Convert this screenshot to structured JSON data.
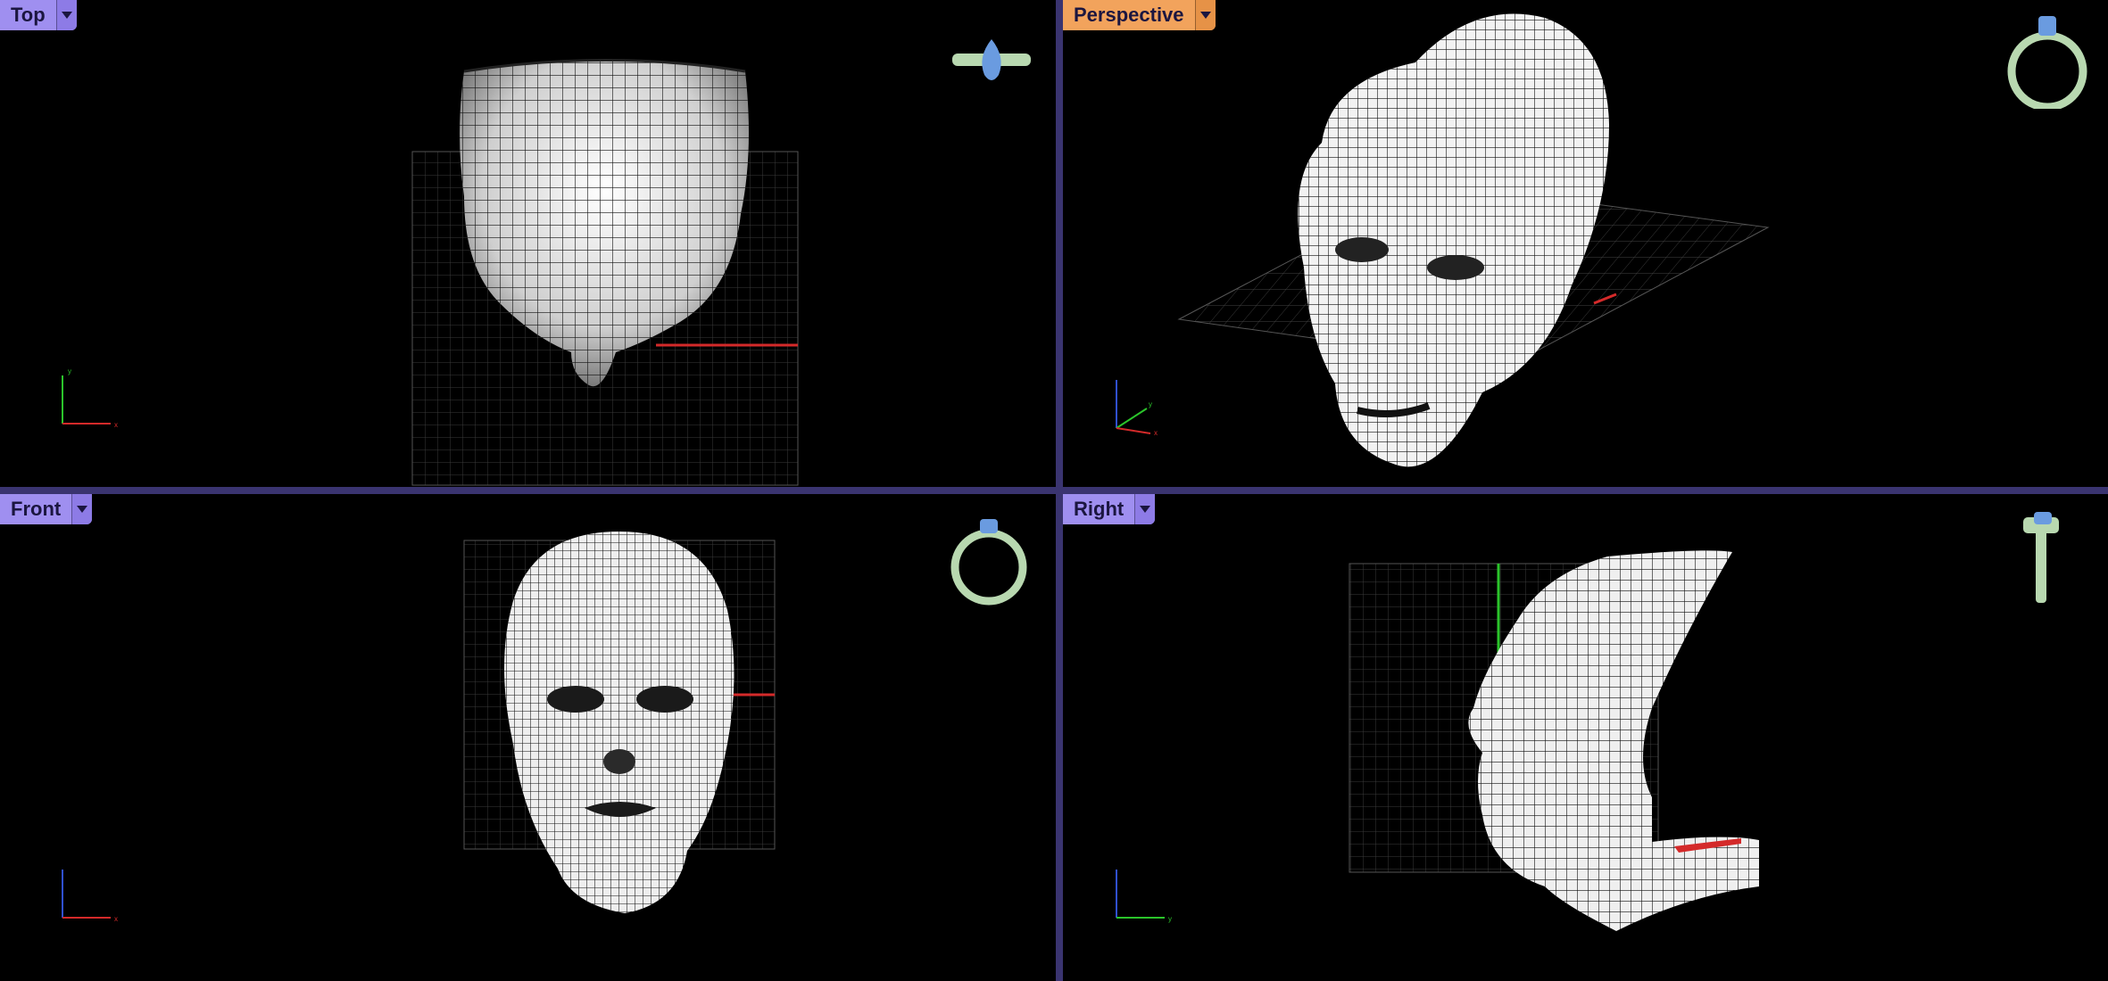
{
  "viewports": {
    "top": {
      "label": "Top"
    },
    "perspective": {
      "label": "Perspective"
    },
    "front": {
      "label": "Front"
    },
    "right": {
      "label": "Right"
    }
  },
  "axes": {
    "x": "x",
    "y": "y",
    "z": "z"
  },
  "colors": {
    "background": "#000000",
    "separator": "#3a3470",
    "tab_inactive": "#9f8ff0",
    "tab_active": "#f2a35c",
    "grid": "#3a3a3a",
    "x_axis": "#d42a2a",
    "y_axis": "#2bc42b",
    "mesh": "#e8e8e8",
    "ring_metal": "#b8d8b0",
    "ring_gem": "#6a9be0"
  },
  "icons": [
    "ring-gizmo-icon",
    "dropdown-arrow-icon",
    "axis-triad-icon"
  ]
}
